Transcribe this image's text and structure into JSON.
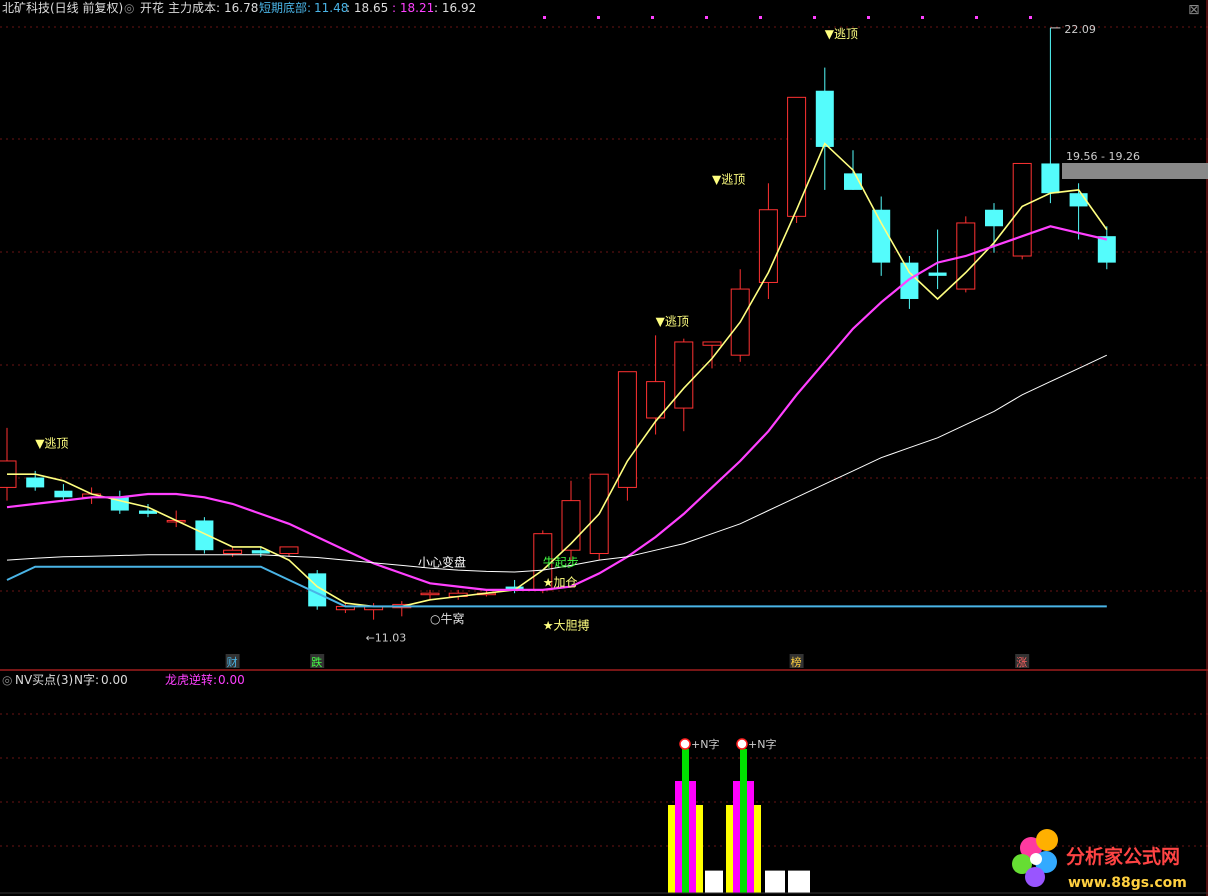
{
  "header": {
    "stock": "北矿科技",
    "period": "(日线 前复权)",
    "indicator": "开花",
    "cost_label": "主力成本:",
    "cost_value": "16.78",
    "bottom_label": "短期底部:",
    "v1": "11.48",
    "v2": ": 18.65",
    "v3": ": 18.21",
    "v4": ": 16.92"
  },
  "sub_header": {
    "title": "NV买点(3)",
    "n_label": "N字:",
    "n_value": "0.00",
    "dragon_label": "龙虎逆转:",
    "dragon_value": "0.00"
  },
  "watermark": {
    "name": "分析家公式网",
    "url": "www.88gs.com"
  },
  "colors": {
    "background": "#000000",
    "up_candle": "#ff3232",
    "down_candle": "#54fcfc",
    "yellow_line": "#ffff80",
    "magenta_line": "#ff40ff",
    "white_line": "#ffffff",
    "blue_line": "#4ab4e6",
    "grid": "#6a1414",
    "sub_green": "#00e000",
    "sub_magenta": "#ff00ff",
    "sub_yellow": "#ffff00",
    "sub_white": "#ffffff"
  },
  "chart_data": [
    {
      "type": "candlestick",
      "price_labels": {
        "high": "22.09",
        "low": "←11.03",
        "range": "19.56 - 19.26"
      },
      "candles": [
        {
          "o": 15.1,
          "h": 16.0,
          "l": 14.9,
          "c": 15.5
        },
        {
          "o": 15.25,
          "h": 15.35,
          "l": 15.05,
          "c": 15.1
        },
        {
          "o": 15.05,
          "h": 15.15,
          "l": 14.9,
          "c": 14.95
        },
        {
          "o": 14.95,
          "h": 15.1,
          "l": 14.85,
          "c": 15.0
        },
        {
          "o": 14.95,
          "h": 15.05,
          "l": 14.7,
          "c": 14.75
        },
        {
          "o": 14.75,
          "h": 14.85,
          "l": 14.65,
          "c": 14.7
        },
        {
          "o": 14.6,
          "h": 14.75,
          "l": 14.5,
          "c": 14.6
        },
        {
          "o": 14.6,
          "h": 14.65,
          "l": 14.1,
          "c": 14.15
        },
        {
          "o": 14.1,
          "h": 14.2,
          "l": 14.05,
          "c": 14.15
        },
        {
          "o": 14.15,
          "h": 14.2,
          "l": 14.05,
          "c": 14.1
        },
        {
          "o": 14.1,
          "h": 14.2,
          "l": 14.05,
          "c": 14.2
        },
        {
          "o": 13.8,
          "h": 13.85,
          "l": 13.25,
          "c": 13.3
        },
        {
          "o": 13.25,
          "h": 13.35,
          "l": 13.2,
          "c": 13.3
        },
        {
          "o": 13.25,
          "h": 13.35,
          "l": 13.1,
          "c": 13.3
        },
        {
          "o": 13.28,
          "h": 13.38,
          "l": 13.15,
          "c": 13.33
        },
        {
          "o": 13.5,
          "h": 13.55,
          "l": 13.4,
          "c": 13.5
        },
        {
          "o": 13.45,
          "h": 13.55,
          "l": 13.4,
          "c": 13.5
        },
        {
          "o": 13.5,
          "h": 13.55,
          "l": 13.45,
          "c": 13.5
        },
        {
          "o": 13.6,
          "h": 13.7,
          "l": 13.5,
          "c": 13.55
        },
        {
          "o": 13.55,
          "h": 14.45,
          "l": 13.5,
          "c": 14.4
        },
        {
          "o": 14.15,
          "h": 15.2,
          "l": 14.0,
          "c": 14.9
        },
        {
          "o": 14.1,
          "h": 15.3,
          "l": 14.0,
          "c": 15.3
        },
        {
          "o": 15.1,
          "h": 16.85,
          "l": 14.9,
          "c": 16.85
        },
        {
          "o": 16.15,
          "h": 17.4,
          "l": 15.9,
          "c": 16.7
        },
        {
          "o": 16.3,
          "h": 17.35,
          "l": 15.95,
          "c": 17.3
        },
        {
          "o": 17.25,
          "h": 17.3,
          "l": 16.9,
          "c": 17.3
        },
        {
          "o": 17.1,
          "h": 18.4,
          "l": 17.0,
          "c": 18.1
        },
        {
          "o": 18.2,
          "h": 19.7,
          "l": 17.95,
          "c": 19.3
        },
        {
          "o": 19.2,
          "h": 20.9,
          "l": 19.1,
          "c": 21.0
        },
        {
          "o": 21.1,
          "h": 21.45,
          "l": 19.6,
          "c": 20.25
        },
        {
          "o": 19.85,
          "h": 20.2,
          "l": 19.6,
          "c": 19.6
        },
        {
          "o": 19.3,
          "h": 19.5,
          "l": 18.3,
          "c": 18.5
        },
        {
          "o": 18.5,
          "h": 18.6,
          "l": 17.8,
          "c": 17.95
        },
        {
          "o": 18.35,
          "h": 19.0,
          "l": 18.1,
          "c": 18.3
        },
        {
          "o": 18.1,
          "h": 19.2,
          "l": 18.05,
          "c": 19.1
        },
        {
          "o": 19.3,
          "h": 19.4,
          "l": 18.65,
          "c": 19.05
        },
        {
          "o": 18.6,
          "h": 20.0,
          "l": 18.55,
          "c": 20.0
        },
        {
          "o": 20.0,
          "h": 22.05,
          "l": 19.4,
          "c": 19.55
        },
        {
          "o": 19.55,
          "h": 19.7,
          "l": 18.85,
          "c": 19.35
        },
        {
          "o": 18.9,
          "h": 19.05,
          "l": 18.4,
          "c": 18.5
        }
      ],
      "series": [
        {
          "type": "line",
          "values": [
            15.3,
            15.3,
            15.2,
            15.0,
            14.9,
            14.8,
            14.6,
            14.4,
            14.2,
            14.2,
            14.0,
            13.6,
            13.35,
            13.3,
            13.3,
            13.4,
            13.45,
            13.5,
            13.55,
            13.85,
            14.25,
            14.7,
            15.5,
            16.1,
            16.6,
            17.05,
            17.6,
            18.35,
            19.3,
            20.3,
            19.9,
            19.1,
            18.35,
            17.95,
            18.35,
            18.8,
            19.35,
            19.55,
            19.6,
            19.0
          ]
        },
        {
          "type": "line",
          "values": [
            14.8,
            14.85,
            14.9,
            14.95,
            14.95,
            15.0,
            15.0,
            14.95,
            14.85,
            14.7,
            14.55,
            14.35,
            14.15,
            13.95,
            13.8,
            13.65,
            13.6,
            13.55,
            13.55,
            13.55,
            13.6,
            13.8,
            14.05,
            14.35,
            14.7,
            15.1,
            15.5,
            15.95,
            16.5,
            17.0,
            17.5,
            17.9,
            18.25,
            18.5,
            18.6,
            18.75,
            18.9,
            19.05,
            18.95,
            18.85
          ]
        },
        {
          "type": "line",
          "values": [
            14.0,
            14.03,
            14.05,
            14.06,
            14.07,
            14.08,
            14.08,
            14.08,
            14.08,
            14.08,
            14.06,
            14.04,
            14.0,
            13.96,
            13.92,
            13.88,
            13.85,
            13.83,
            13.82,
            13.85,
            13.92,
            14.0,
            14.05,
            14.15,
            14.25,
            14.4,
            14.55,
            14.75,
            14.95,
            15.15,
            15.35,
            15.55,
            15.7,
            15.85,
            16.05,
            16.25,
            16.5,
            16.7,
            16.9,
            17.1
          ]
        },
        {
          "type": "line",
          "values": [
            13.7,
            13.9,
            13.9,
            13.9,
            13.9,
            13.9,
            13.9,
            13.9,
            13.9,
            13.9,
            13.7,
            13.5,
            13.3,
            13.3,
            13.3,
            13.3,
            13.3,
            13.3,
            13.3,
            13.3,
            13.3,
            13.3,
            13.3,
            13.3,
            13.3,
            13.3,
            13.3,
            13.3,
            13.3,
            13.3,
            13.3,
            13.3,
            13.3,
            13.3,
            13.3,
            13.3,
            13.3,
            13.3,
            13.3,
            13.3
          ]
        }
      ],
      "annotations": [
        {
          "i": 1,
          "text": "▼逃顶",
          "price": 15.7
        },
        {
          "i": 23,
          "text": "▼逃顶",
          "price": 17.55
        },
        {
          "i": 25,
          "text": "▼逃顶",
          "price": 19.7
        },
        {
          "i": 29,
          "text": "▼逃顶",
          "price": 21.9
        },
        {
          "i": 15,
          "text": "小心变盘",
          "price": 13.9
        },
        {
          "i": 19,
          "text": "牛起步",
          "price": 13.9
        },
        {
          "i": 19,
          "text": "★加仓",
          "price": 13.6
        },
        {
          "i": 15,
          "text": "○牛窝",
          "price": 13.05
        },
        {
          "i": 19,
          "text": "★大胆搏",
          "price": 12.95
        }
      ],
      "bottom_markers": [
        {
          "i": 8,
          "text": "财"
        },
        {
          "i": 11,
          "text": "跌"
        },
        {
          "i": 28,
          "text": "榜"
        },
        {
          "i": 36,
          "text": "涨"
        }
      ]
    },
    {
      "type": "bar",
      "title": "NV买点(3)",
      "markers": [
        {
          "text": "+N字"
        },
        {
          "text": "+N字"
        }
      ],
      "bars": [
        {
          "color": "sub_yellow",
          "value": 0.55
        },
        {
          "color": "sub_magenta",
          "value": 0.7
        },
        {
          "color": "sub_green",
          "value": 0.9
        },
        {
          "color": "sub_magenta",
          "value": 0.7
        },
        {
          "color": "sub_yellow",
          "value": 0.55
        },
        {
          "color": "sub_white",
          "value": 0.14
        },
        {
          "color": "sub_yellow",
          "value": 0.55
        },
        {
          "color": "sub_magenta",
          "value": 0.7
        },
        {
          "color": "sub_green",
          "value": 0.9
        },
        {
          "color": "sub_magenta",
          "value": 0.7
        },
        {
          "color": "sub_yellow",
          "value": 0.55
        },
        {
          "color": "sub_white",
          "value": 0.14
        },
        {
          "color": "sub_white",
          "value": 0.14
        }
      ]
    }
  ]
}
